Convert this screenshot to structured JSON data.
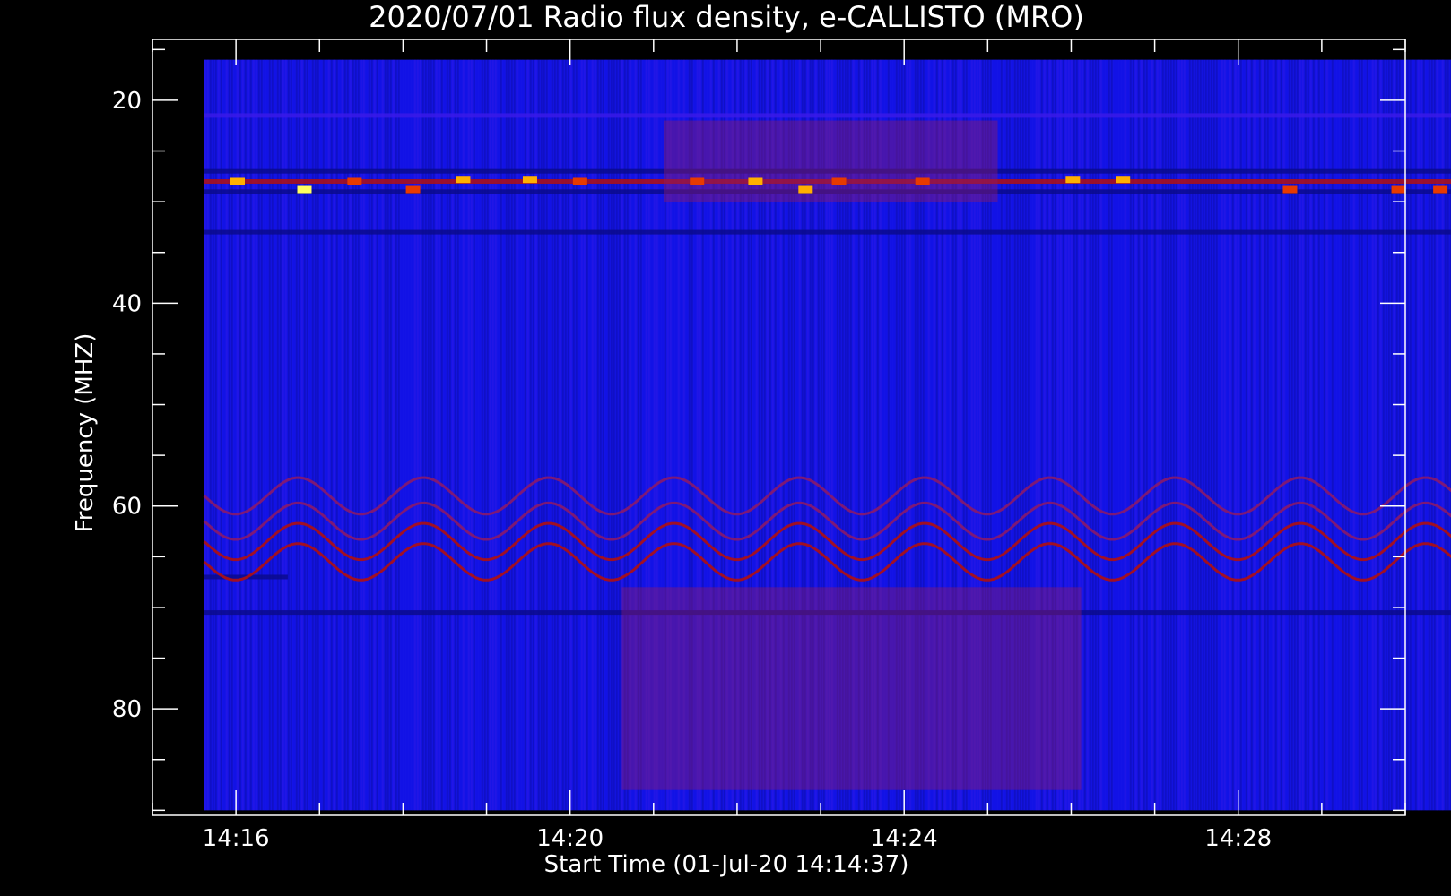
{
  "chart_data": {
    "type": "heatmap",
    "title": "2020/07/01  Radio flux density, e-CALLISTO (MRO)",
    "xlabel": "Start Time (01-Jul-20 14:14:37)",
    "ylabel": "Frequency (MHZ)",
    "x_axis": {
      "unit": "minutes since 14:14:37",
      "range": [
        0.38,
        15.38
      ],
      "major_ticks": [
        {
          "value": 1.38,
          "label": "14:16"
        },
        {
          "value": 5.38,
          "label": "14:20"
        },
        {
          "value": 9.38,
          "label": "14:24"
        },
        {
          "value": 13.38,
          "label": "14:28"
        }
      ],
      "minor_step": 1
    },
    "y_axis": {
      "reversed": true,
      "range": [
        14.0,
        90.5
      ],
      "major_ticks": [
        {
          "value": 20,
          "label": "20"
        },
        {
          "value": 40,
          "label": "40"
        },
        {
          "value": 60,
          "label": "60"
        },
        {
          "value": 80,
          "label": "80"
        }
      ],
      "minor_step": 5
    },
    "data_extent": {
      "x": [
        1.0,
        16.0
      ],
      "y": [
        16.0,
        90.0
      ]
    },
    "colormap": [
      "#0a0a8c",
      "#1010e8",
      "#3a1ae8",
      "#8a1a6a",
      "#b01010",
      "#e83a00",
      "#ffb000",
      "#ffff60"
    ],
    "background_color": "#1414e6",
    "features": [
      {
        "type": "band",
        "freq": 21.5,
        "t_range": [
          1.0,
          16.0
        ],
        "level": 2
      },
      {
        "type": "band",
        "freq": 27.0,
        "t_range": [
          1.0,
          16.0
        ],
        "level": 0
      },
      {
        "type": "band",
        "freq": 28.0,
        "t_range": [
          1.0,
          16.0
        ],
        "level": 4
      },
      {
        "type": "band",
        "freq": 29.0,
        "t_range": [
          1.0,
          16.0
        ],
        "level": 0
      },
      {
        "type": "band",
        "freq": 33.0,
        "t_range": [
          1.0,
          16.0
        ],
        "level": 0
      },
      {
        "type": "band",
        "freq": 70.5,
        "t_range": [
          1.0,
          16.0
        ],
        "level": 0
      },
      {
        "type": "band",
        "freq": 67.0,
        "t_range": [
          1.0,
          2.0
        ],
        "level": 0
      },
      {
        "type": "patch",
        "t_range": [
          6.5,
          10.5
        ],
        "f_range": [
          22.0,
          30.0
        ],
        "level": 3
      },
      {
        "type": "patch",
        "t_range": [
          6.0,
          11.5
        ],
        "f_range": [
          68.0,
          88.0
        ],
        "level": 3
      },
      {
        "type": "wave",
        "freq": 59.0,
        "amp": 1.8,
        "period": 1.5,
        "level": 3
      },
      {
        "type": "wave",
        "freq": 61.5,
        "amp": 1.8,
        "period": 1.5,
        "level": 3
      },
      {
        "type": "wave",
        "freq": 63.5,
        "amp": 1.8,
        "period": 1.5,
        "level": 4
      },
      {
        "type": "wave",
        "freq": 65.5,
        "amp": 1.8,
        "period": 1.5,
        "level": 4
      }
    ],
    "bursts": [
      {
        "t": 1.4,
        "f": 28.0,
        "level": 6
      },
      {
        "t": 2.2,
        "f": 28.8,
        "level": 7
      },
      {
        "t": 2.8,
        "f": 28.0,
        "level": 5
      },
      {
        "t": 3.5,
        "f": 28.8,
        "level": 5
      },
      {
        "t": 4.1,
        "f": 27.8,
        "level": 6
      },
      {
        "t": 4.9,
        "f": 27.8,
        "level": 6
      },
      {
        "t": 5.5,
        "f": 28.0,
        "level": 5
      },
      {
        "t": 6.9,
        "f": 28.0,
        "level": 5
      },
      {
        "t": 7.6,
        "f": 28.0,
        "level": 6
      },
      {
        "t": 8.2,
        "f": 28.8,
        "level": 6
      },
      {
        "t": 8.6,
        "f": 28.0,
        "level": 5
      },
      {
        "t": 9.6,
        "f": 28.0,
        "level": 5
      },
      {
        "t": 11.4,
        "f": 27.8,
        "level": 6
      },
      {
        "t": 12.0,
        "f": 27.8,
        "level": 6
      },
      {
        "t": 14.0,
        "f": 28.8,
        "level": 5
      },
      {
        "t": 15.3,
        "f": 28.8,
        "level": 5
      },
      {
        "t": 15.8,
        "f": 28.8,
        "level": 5
      }
    ]
  }
}
